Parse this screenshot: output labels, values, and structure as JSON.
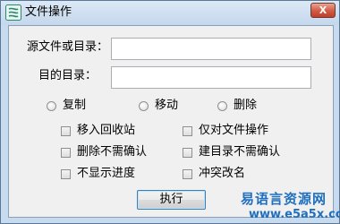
{
  "window": {
    "title": "文件操作",
    "close_glyph": "X",
    "icon": "file-ops-icon"
  },
  "form": {
    "source_label": "源文件或目录：",
    "source_value": "",
    "dest_label": "目的目录：",
    "dest_value": ""
  },
  "radios": [
    {
      "label": "复制",
      "selected": false
    },
    {
      "label": "移动",
      "selected": false
    },
    {
      "label": "删除",
      "selected": false
    }
  ],
  "checkboxes": [
    {
      "label": "移入回收站",
      "checked": false
    },
    {
      "label": "仅对文件操作",
      "checked": false
    },
    {
      "label": "删除不需确认",
      "checked": false
    },
    {
      "label": "建目录不需确认",
      "checked": false
    },
    {
      "label": "不显示进度",
      "checked": false
    },
    {
      "label": "冲突改名",
      "checked": false
    }
  ],
  "buttons": {
    "execute_label": "执行"
  },
  "watermark": {
    "title": "易语言资源网",
    "url": "www.e5a5x.com"
  },
  "colors": {
    "frame": "#c8dbee",
    "client": "#f0f0f0",
    "close": "#c94a35",
    "watermark": "#1f6fbf"
  }
}
